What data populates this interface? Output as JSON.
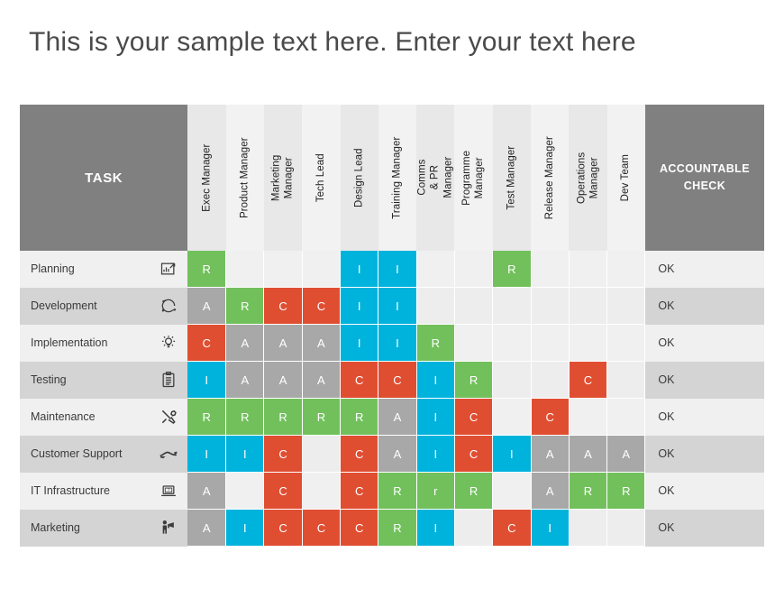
{
  "title": "This is your sample text here. Enter your text here",
  "header": {
    "task_label": "TASK",
    "accountable_label_line1": "ACCOUNTABLE",
    "accountable_label_line2": "CHECK",
    "roles": [
      "Exec Manager",
      "Product Manager",
      "Marketing Manager",
      "Tech Lead",
      "Design Lead",
      "Training Manager",
      "Comms & PR Manager",
      "Programme Manager",
      "Test Manager",
      "Release Manager",
      "Operations Manager",
      "Dev Team"
    ]
  },
  "colors": {
    "header_gray": "#808080",
    "responsible_green": "#72C05C",
    "accountable_gray": "#a8a8a8",
    "consulted_red": "#e04e32",
    "informed_cyan": "#00b3dc",
    "row_light": "#f0f0f0",
    "row_dark": "#d4d4d4",
    "title_text": "#4a4a4a"
  },
  "rows": [
    {
      "task": "Planning",
      "icon": "chart-board-icon",
      "values": [
        "R",
        "",
        "",
        "",
        "I",
        "I",
        "",
        "",
        "R",
        "",
        "",
        ""
      ],
      "accountable_check": "OK"
    },
    {
      "task": "Development",
      "icon": "cycle-arrows-icon",
      "values": [
        "A",
        "R",
        "C",
        "C",
        "I",
        "I",
        "",
        "",
        "",
        "",
        "",
        ""
      ],
      "accountable_check": "OK"
    },
    {
      "task": "Implementation",
      "icon": "lightbulb-idea-icon",
      "values": [
        "C",
        "A",
        "A",
        "A",
        "I",
        "I",
        "R",
        "",
        "",
        "",
        "",
        ""
      ],
      "accountable_check": "OK"
    },
    {
      "task": "Testing",
      "icon": "clipboard-checklist-icon",
      "values": [
        "I",
        "A",
        "A",
        "A",
        "C",
        "C",
        "I",
        "R",
        "",
        "",
        "C",
        ""
      ],
      "accountable_check": "OK"
    },
    {
      "task": "Maintenance",
      "icon": "tools-wrench-icon",
      "values": [
        "R",
        "R",
        "R",
        "R",
        "R",
        "A",
        "I",
        "C",
        "",
        "C",
        "",
        ""
      ],
      "accountable_check": "OK"
    },
    {
      "task": "Customer Support",
      "icon": "handshake-icon",
      "values": [
        "I",
        "I",
        "C",
        "",
        "C",
        "A",
        "I",
        "C",
        "I",
        "A",
        "A",
        "A"
      ],
      "accountable_check": "OK"
    },
    {
      "task": "IT Infrastructure",
      "icon": "laptop-icon",
      "values": [
        "A",
        "",
        "C",
        "",
        "C",
        "R",
        "r",
        "R",
        "",
        "A",
        "R",
        "R"
      ],
      "accountable_check": "OK"
    },
    {
      "task": "Marketing",
      "icon": "megaphone-person-icon",
      "values": [
        "A",
        "I",
        "C",
        "C",
        "C",
        "R",
        "I",
        "",
        "C",
        "I",
        "",
        ""
      ],
      "accountable_check": "OK"
    }
  ]
}
